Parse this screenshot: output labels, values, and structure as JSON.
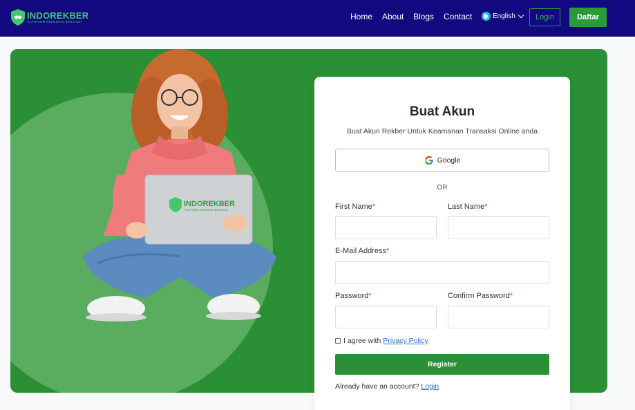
{
  "nav": {
    "brand_name": "INDOREKBER",
    "brand_tagline": "PLATFORM REKENING BERSAMA",
    "links": [
      "Home",
      "About",
      "Blogs",
      "Contact"
    ],
    "language": "English",
    "login_label": "Login",
    "signup_label": "Daftar"
  },
  "hero": {
    "laptop_brand": "INDOREKBER",
    "laptop_tagline": "PLATFORM REKENING BERSAMA"
  },
  "form": {
    "title": "Buat Akun",
    "subtitle": "Buat Akun Rekber Untuk Keamanan Transaksi Online anda",
    "google_label": "Google",
    "or_label": "OR",
    "first_name_label": "First Name",
    "last_name_label": "Last Name",
    "email_label": "E-Mail Address",
    "password_label": "Password",
    "confirm_password_label": "Confirm Password",
    "required_mark": "*",
    "agree_text": "I agree with",
    "privacy_link": "Privacy Policy",
    "register_label": "Register",
    "already_text": "Already have an account?",
    "login_link": "Login"
  },
  "colors": {
    "navbar": "#12087f",
    "brand_green": "#2b8f36",
    "accent_green": "#43c96d",
    "required": "#d0313a",
    "link": "#2a6fd6"
  },
  "icons": [
    "shield-logo-icon",
    "globe-icon",
    "chevron-down-icon",
    "google-icon"
  ]
}
